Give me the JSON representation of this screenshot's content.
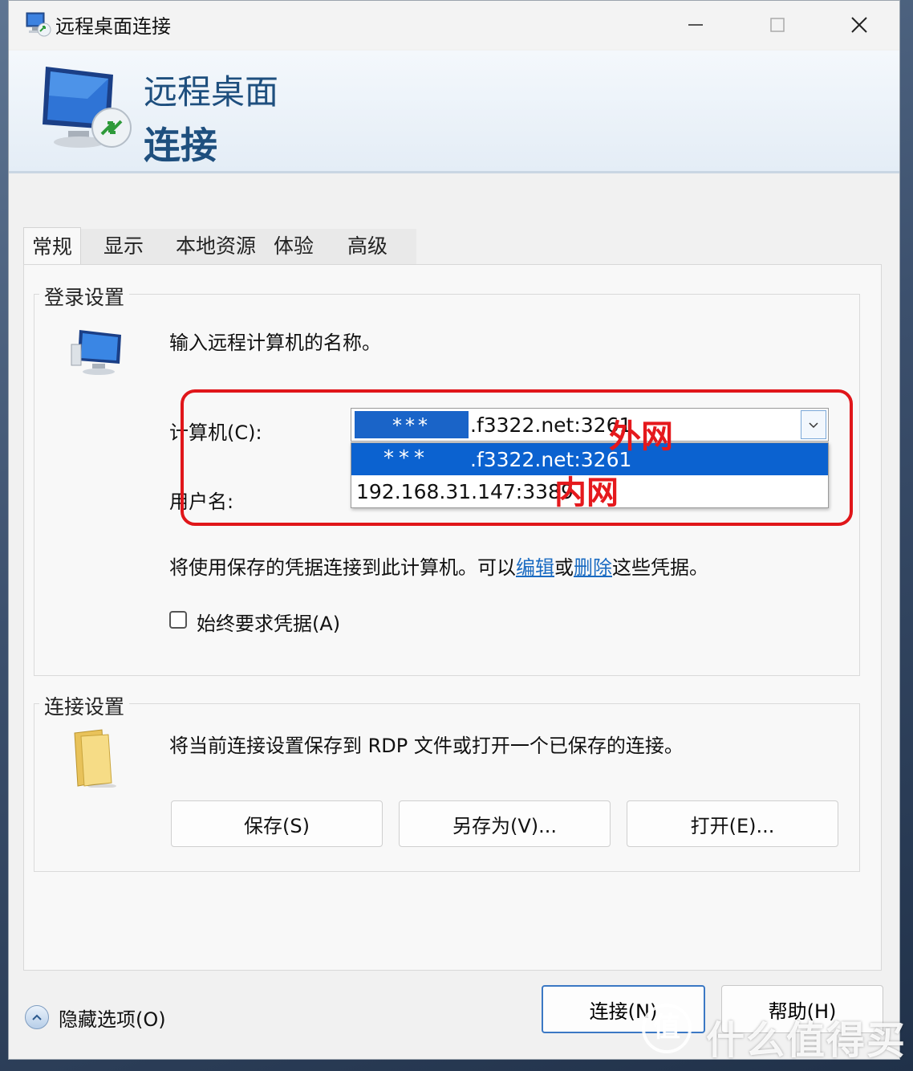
{
  "window": {
    "title": "远程桌面连接",
    "controls": {
      "minimize": "—",
      "maximize": "☐",
      "close": "✕"
    }
  },
  "banner": {
    "line1": "远程桌面",
    "line2": "连接"
  },
  "tabs": [
    {
      "label": "常规",
      "active": true
    },
    {
      "label": "显示"
    },
    {
      "label": "本地资源"
    },
    {
      "label": "体验"
    },
    {
      "label": "高级"
    }
  ],
  "login_group": {
    "title": "登录设置",
    "instruction": "输入远程计算机的名称。",
    "computer_label": "计算机(C):",
    "computer_value_masked": "***",
    "computer_value_suffix": ".f3322.net:3261",
    "username_label": "用户名:",
    "dropdown_options": [
      {
        "masked": "***",
        "suffix": ".f3322.net:3261",
        "highlighted": true
      },
      {
        "text": "192.168.31.147:3389"
      }
    ],
    "annotations": {
      "external": "外网",
      "internal": "内网"
    },
    "credentials_text_pre": "将使用保存的凭据连接到此计算机。可以",
    "edit_link": "编辑",
    "credentials_mid": "或",
    "delete_link": "删除",
    "credentials_post": "这些凭据。",
    "always_ask_label": "始终要求凭据(A)",
    "always_ask_checked": false
  },
  "connection_group": {
    "title": "连接设置",
    "description": "将当前连接设置保存到 RDP 文件或打开一个已保存的连接。",
    "buttons": {
      "save": "保存(S)",
      "save_as": "另存为(V)...",
      "open": "打开(E)..."
    }
  },
  "footer": {
    "hide_options": "隐藏选项(O)",
    "connect": "连接(N)",
    "help": "帮助(H)"
  },
  "watermark": {
    "icon": "值",
    "text": "什么值得买"
  },
  "colors": {
    "accent": "#1a64c8",
    "annotation_red": "#e0161a",
    "banner_text": "#1e4f7e",
    "link": "#1a6bc2"
  }
}
